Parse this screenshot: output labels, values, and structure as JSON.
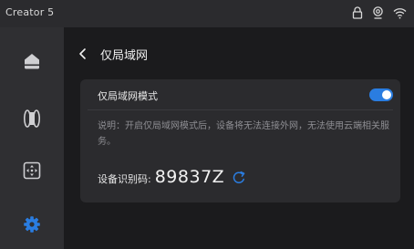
{
  "window": {
    "title": "Creator 5"
  },
  "statusbar": {
    "icons": [
      "lock-icon",
      "camera-icon",
      "wifi-icon"
    ]
  },
  "sidebar": {
    "items": [
      {
        "icon": "home-icon",
        "active": false
      },
      {
        "icon": "filament-spool-icon",
        "active": false
      },
      {
        "icon": "move-control-icon",
        "active": false
      },
      {
        "icon": "settings-gear-icon",
        "active": true
      }
    ]
  },
  "page": {
    "title": "仅局域网"
  },
  "lan_mode": {
    "label": "仅局域网模式",
    "enabled": true,
    "description": "说明：开启仅局域网模式后，设备将无法连接外网，无法使用云端相关服务。",
    "device_id_label": "设备识别码:",
    "device_id_value": "89837Z"
  },
  "colors": {
    "accent": "#2a7de1",
    "background": "#1b1b1d",
    "card": "#2b2b2e",
    "sidebar": "#2f2f32"
  }
}
